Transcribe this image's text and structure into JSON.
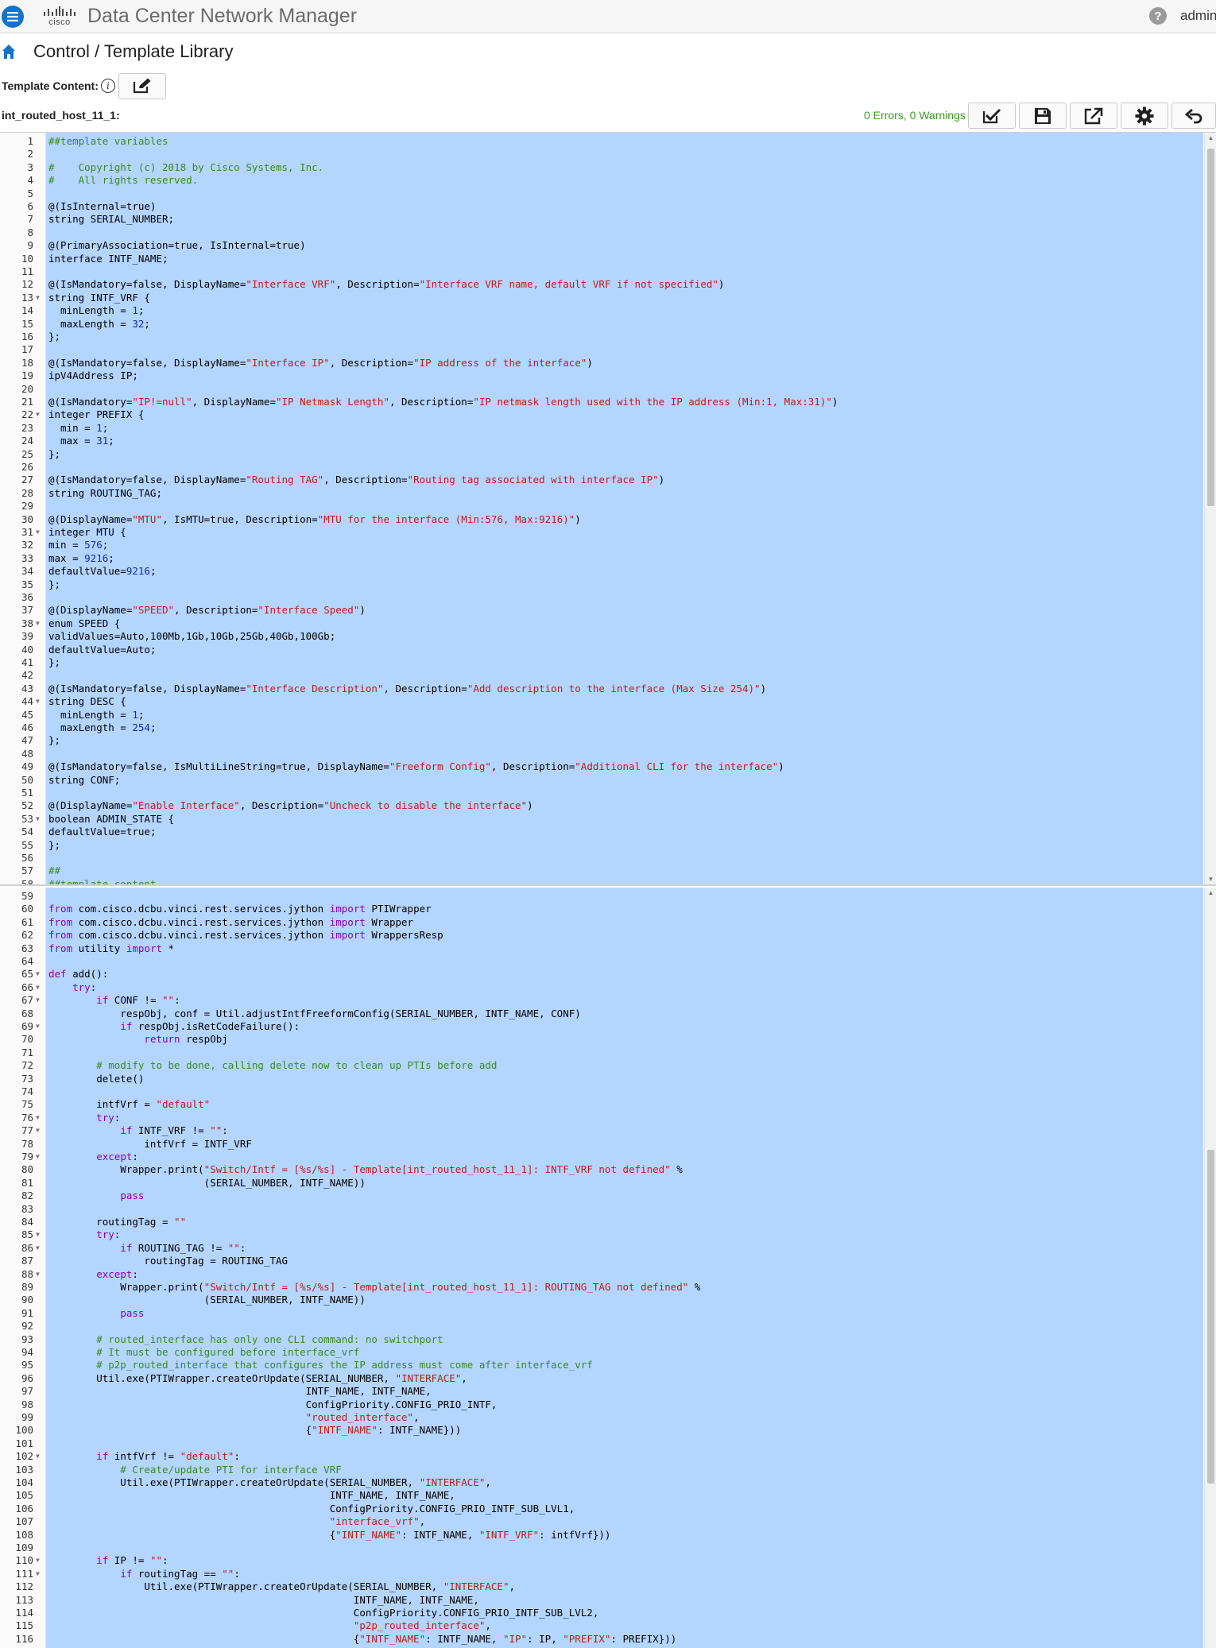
{
  "app": {
    "brand": "cisco",
    "title": "Data Center Network Manager",
    "user": "admin",
    "help": "?"
  },
  "breadcrumb": "Control / Template Library",
  "template": {
    "label": "Template Content:",
    "info_symbol": "i",
    "file_name": "int_routed_host_11_1:",
    "status": "0 Errors, 0 Warnings"
  },
  "toolbar_icons": [
    "validate-icon",
    "save-icon",
    "export-icon",
    "settings-icon",
    "undo-icon"
  ],
  "colors": {
    "selection": "#b4d5fe",
    "comment": "#3c8a1a",
    "string": "#c41a16",
    "keyword": "#8b00b5",
    "status_ok": "#3c9a1e",
    "accent": "#1572c9"
  },
  "editor": {
    "top_pane": [
      {
        "n": "1",
        "text": "##template variables"
      },
      {
        "n": "2",
        "text": ""
      },
      {
        "n": "3",
        "text": "#    Copyright (c) 2018 by Cisco Systems, Inc."
      },
      {
        "n": "4",
        "text": "#    All rights reserved."
      },
      {
        "n": "5",
        "text": ""
      },
      {
        "n": "6",
        "text": "@(IsInternal=true)"
      },
      {
        "n": "7",
        "text": "string SERIAL_NUMBER;"
      },
      {
        "n": "8",
        "text": ""
      },
      {
        "n": "9",
        "text": "@(PrimaryAssociation=true, IsInternal=true)"
      },
      {
        "n": "10",
        "text": "interface INTF_NAME;"
      },
      {
        "n": "11",
        "text": ""
      },
      {
        "n": "12",
        "text": "@(IsMandatory=false, DisplayName=\"Interface VRF\", Description=\"Interface VRF name, default VRF if not specified\")"
      },
      {
        "n": "13",
        "text": "string INTF_VRF {",
        "fold": true
      },
      {
        "n": "14",
        "text": "  minLength = 1;"
      },
      {
        "n": "15",
        "text": "  maxLength = 32;"
      },
      {
        "n": "16",
        "text": "};"
      },
      {
        "n": "17",
        "text": ""
      },
      {
        "n": "18",
        "text": "@(IsMandatory=false, DisplayName=\"Interface IP\", Description=\"IP address of the interface\")"
      },
      {
        "n": "19",
        "text": "ipV4Address IP;"
      },
      {
        "n": "20",
        "text": ""
      },
      {
        "n": "21",
        "text": "@(IsMandatory=\"IP!=null\", DisplayName=\"IP Netmask Length\", Description=\"IP netmask length used with the IP address (Min:1, Max:31)\")"
      },
      {
        "n": "22",
        "text": "integer PREFIX {",
        "fold": true
      },
      {
        "n": "23",
        "text": "  min = 1;"
      },
      {
        "n": "24",
        "text": "  max = 31;"
      },
      {
        "n": "25",
        "text": "};"
      },
      {
        "n": "26",
        "text": ""
      },
      {
        "n": "27",
        "text": "@(IsMandatory=false, DisplayName=\"Routing TAG\", Description=\"Routing tag associated with interface IP\")"
      },
      {
        "n": "28",
        "text": "string ROUTING_TAG;"
      },
      {
        "n": "29",
        "text": ""
      },
      {
        "n": "30",
        "text": "@(DisplayName=\"MTU\", IsMTU=true, Description=\"MTU for the interface (Min:576, Max:9216)\")"
      },
      {
        "n": "31",
        "text": "integer MTU {",
        "fold": true
      },
      {
        "n": "32",
        "text": "min = 576;"
      },
      {
        "n": "33",
        "text": "max = 9216;"
      },
      {
        "n": "34",
        "text": "defaultValue=9216;"
      },
      {
        "n": "35",
        "text": "};"
      },
      {
        "n": "36",
        "text": ""
      },
      {
        "n": "37",
        "text": "@(DisplayName=\"SPEED\", Description=\"Interface Speed\")"
      },
      {
        "n": "38",
        "text": "enum SPEED {",
        "fold": true
      },
      {
        "n": "39",
        "text": "validValues=Auto,100Mb,1Gb,10Gb,25Gb,40Gb,100Gb;"
      },
      {
        "n": "40",
        "text": "defaultValue=Auto;"
      },
      {
        "n": "41",
        "text": "};"
      },
      {
        "n": "42",
        "text": ""
      },
      {
        "n": "43",
        "text": "@(IsMandatory=false, DisplayName=\"Interface Description\", Description=\"Add description to the interface (Max Size 254)\")"
      },
      {
        "n": "44",
        "text": "string DESC {",
        "fold": true
      },
      {
        "n": "45",
        "text": "  minLength = 1;"
      },
      {
        "n": "46",
        "text": "  maxLength = 254;"
      },
      {
        "n": "47",
        "text": "};"
      },
      {
        "n": "48",
        "text": ""
      },
      {
        "n": "49",
        "text": "@(IsMandatory=false, IsMultiLineString=true, DisplayName=\"Freeform Config\", Description=\"Additional CLI for the interface\")"
      },
      {
        "n": "50",
        "text": "string CONF;"
      },
      {
        "n": "51",
        "text": ""
      },
      {
        "n": "52",
        "text": "@(DisplayName=\"Enable Interface\", Description=\"Uncheck to disable the interface\")"
      },
      {
        "n": "53",
        "text": "boolean ADMIN_STATE {",
        "fold": true
      },
      {
        "n": "54",
        "text": "defaultValue=true;"
      },
      {
        "n": "55",
        "text": "};"
      },
      {
        "n": "56",
        "text": ""
      },
      {
        "n": "57",
        "text": "##"
      },
      {
        "n": "58",
        "text": "##template content"
      }
    ],
    "bottom_pane": [
      {
        "n": "59",
        "text": ""
      },
      {
        "n": "60",
        "text": "from com.cisco.dcbu.vinci.rest.services.jython import PTIWrapper"
      },
      {
        "n": "61",
        "text": "from com.cisco.dcbu.vinci.rest.services.jython import Wrapper"
      },
      {
        "n": "62",
        "text": "from com.cisco.dcbu.vinci.rest.services.jython import WrappersResp"
      },
      {
        "n": "63",
        "text": "from utility import *"
      },
      {
        "n": "64",
        "text": ""
      },
      {
        "n": "65",
        "text": "def add():",
        "fold": true
      },
      {
        "n": "66",
        "text": "    try:",
        "fold": true
      },
      {
        "n": "67",
        "text": "        if CONF != \"\":",
        "fold": true
      },
      {
        "n": "68",
        "text": "            respObj, conf = Util.adjustIntfFreeformConfig(SERIAL_NUMBER, INTF_NAME, CONF)"
      },
      {
        "n": "69",
        "text": "            if respObj.isRetCodeFailure():",
        "fold": true
      },
      {
        "n": "70",
        "text": "                return respObj"
      },
      {
        "n": "71",
        "text": ""
      },
      {
        "n": "72",
        "text": "        # modify to be done, calling delete now to clean up PTIs before add"
      },
      {
        "n": "73",
        "text": "        delete()"
      },
      {
        "n": "74",
        "text": ""
      },
      {
        "n": "75",
        "text": "        intfVrf = \"default\""
      },
      {
        "n": "76",
        "text": "        try:",
        "fold": true
      },
      {
        "n": "77",
        "text": "            if INTF_VRF != \"\":",
        "fold": true
      },
      {
        "n": "78",
        "text": "                intfVrf = INTF_VRF"
      },
      {
        "n": "79",
        "text": "        except:",
        "fold": true
      },
      {
        "n": "80",
        "text": "            Wrapper.print(\"Switch/Intf = [%s/%s] - Template[int_routed_host_11_1]: INTF_VRF not defined\" %"
      },
      {
        "n": "81",
        "text": "                          (SERIAL_NUMBER, INTF_NAME))"
      },
      {
        "n": "82",
        "text": "            pass"
      },
      {
        "n": "83",
        "text": ""
      },
      {
        "n": "84",
        "text": "        routingTag = \"\""
      },
      {
        "n": "85",
        "text": "        try:",
        "fold": true
      },
      {
        "n": "86",
        "text": "            if ROUTING_TAG != \"\":",
        "fold": true
      },
      {
        "n": "87",
        "text": "                routingTag = ROUTING_TAG"
      },
      {
        "n": "88",
        "text": "        except:",
        "fold": true
      },
      {
        "n": "89",
        "text": "            Wrapper.print(\"Switch/Intf = [%s/%s] - Template[int_routed_host_11_1]: ROUTING_TAG not defined\" %"
      },
      {
        "n": "90",
        "text": "                          (SERIAL_NUMBER, INTF_NAME))"
      },
      {
        "n": "91",
        "text": "            pass"
      },
      {
        "n": "92",
        "text": ""
      },
      {
        "n": "93",
        "text": "        # routed_interface has only one CLI command: no switchport"
      },
      {
        "n": "94",
        "text": "        # It must be configured before interface_vrf"
      },
      {
        "n": "95",
        "text": "        # p2p_routed_interface that configures the IP address must come after interface_vrf"
      },
      {
        "n": "96",
        "text": "        Util.exe(PTIWrapper.createOrUpdate(SERIAL_NUMBER, \"INTERFACE\","
      },
      {
        "n": "97",
        "text": "                                           INTF_NAME, INTF_NAME,"
      },
      {
        "n": "98",
        "text": "                                           ConfigPriority.CONFIG_PRIO_INTF,"
      },
      {
        "n": "99",
        "text": "                                           \"routed_interface\","
      },
      {
        "n": "100",
        "text": "                                           {\"INTF_NAME\": INTF_NAME}))"
      },
      {
        "n": "101",
        "text": ""
      },
      {
        "n": "102",
        "text": "        if intfVrf != \"default\":",
        "fold": true
      },
      {
        "n": "103",
        "text": "            # Create/update PTI for interface VRF"
      },
      {
        "n": "104",
        "text": "            Util.exe(PTIWrapper.createOrUpdate(SERIAL_NUMBER, \"INTERFACE\","
      },
      {
        "n": "105",
        "text": "                                               INTF_NAME, INTF_NAME,"
      },
      {
        "n": "106",
        "text": "                                               ConfigPriority.CONFIG_PRIO_INTF_SUB_LVL1,"
      },
      {
        "n": "107",
        "text": "                                               \"interface_vrf\","
      },
      {
        "n": "108",
        "text": "                                               {\"INTF_NAME\": INTF_NAME, \"INTF_VRF\": intfVrf}))"
      },
      {
        "n": "109",
        "text": ""
      },
      {
        "n": "110",
        "text": "        if IP != \"\":",
        "fold": true
      },
      {
        "n": "111",
        "text": "            if routingTag == \"\":",
        "fold": true
      },
      {
        "n": "112",
        "text": "                Util.exe(PTIWrapper.createOrUpdate(SERIAL_NUMBER, \"INTERFACE\","
      },
      {
        "n": "113",
        "text": "                                                   INTF_NAME, INTF_NAME,"
      },
      {
        "n": "114",
        "text": "                                                   ConfigPriority.CONFIG_PRIO_INTF_SUB_LVL2,"
      },
      {
        "n": "115",
        "text": "                                                   \"p2p_routed_interface\","
      },
      {
        "n": "116",
        "text": "                                                   {\"INTF_NAME\": INTF_NAME, \"IP\": IP, \"PREFIX\": PREFIX}))"
      }
    ]
  }
}
